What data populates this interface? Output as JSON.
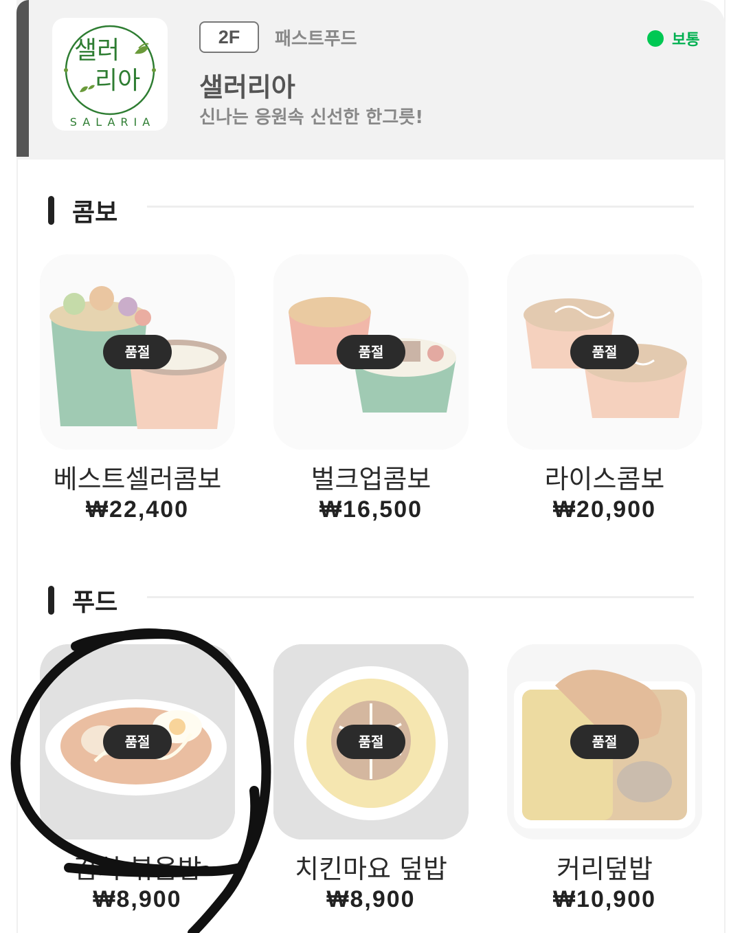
{
  "store": {
    "floor": "2F",
    "category": "패스트푸드",
    "status": "보통",
    "status_color": "#00c853",
    "name": "샐러리아",
    "description": "신나는 응원속 신선한 한그릇!",
    "logo": {
      "line1": "샐러",
      "line2": "리아",
      "wordmark": "SALARIA",
      "brand_color": "#2e7d32"
    }
  },
  "sections": [
    {
      "title": "콤보",
      "items": [
        {
          "name": "베스트셀러콤보",
          "price": "₩22,400",
          "badge": "품절"
        },
        {
          "name": "벌크업콤보",
          "price": "₩16,500",
          "badge": "품절"
        },
        {
          "name": "라이스콤보",
          "price": "₩20,900",
          "badge": "품절"
        }
      ]
    },
    {
      "title": "푸드",
      "items": [
        {
          "name": "김치 볶음밥",
          "price": "₩8,900",
          "badge": "품절"
        },
        {
          "name": "치킨마요 덮밥",
          "price": "₩8,900",
          "badge": "품절"
        },
        {
          "name": "커리덮밥",
          "price": "₩10,900",
          "badge": "품절"
        }
      ]
    }
  ]
}
